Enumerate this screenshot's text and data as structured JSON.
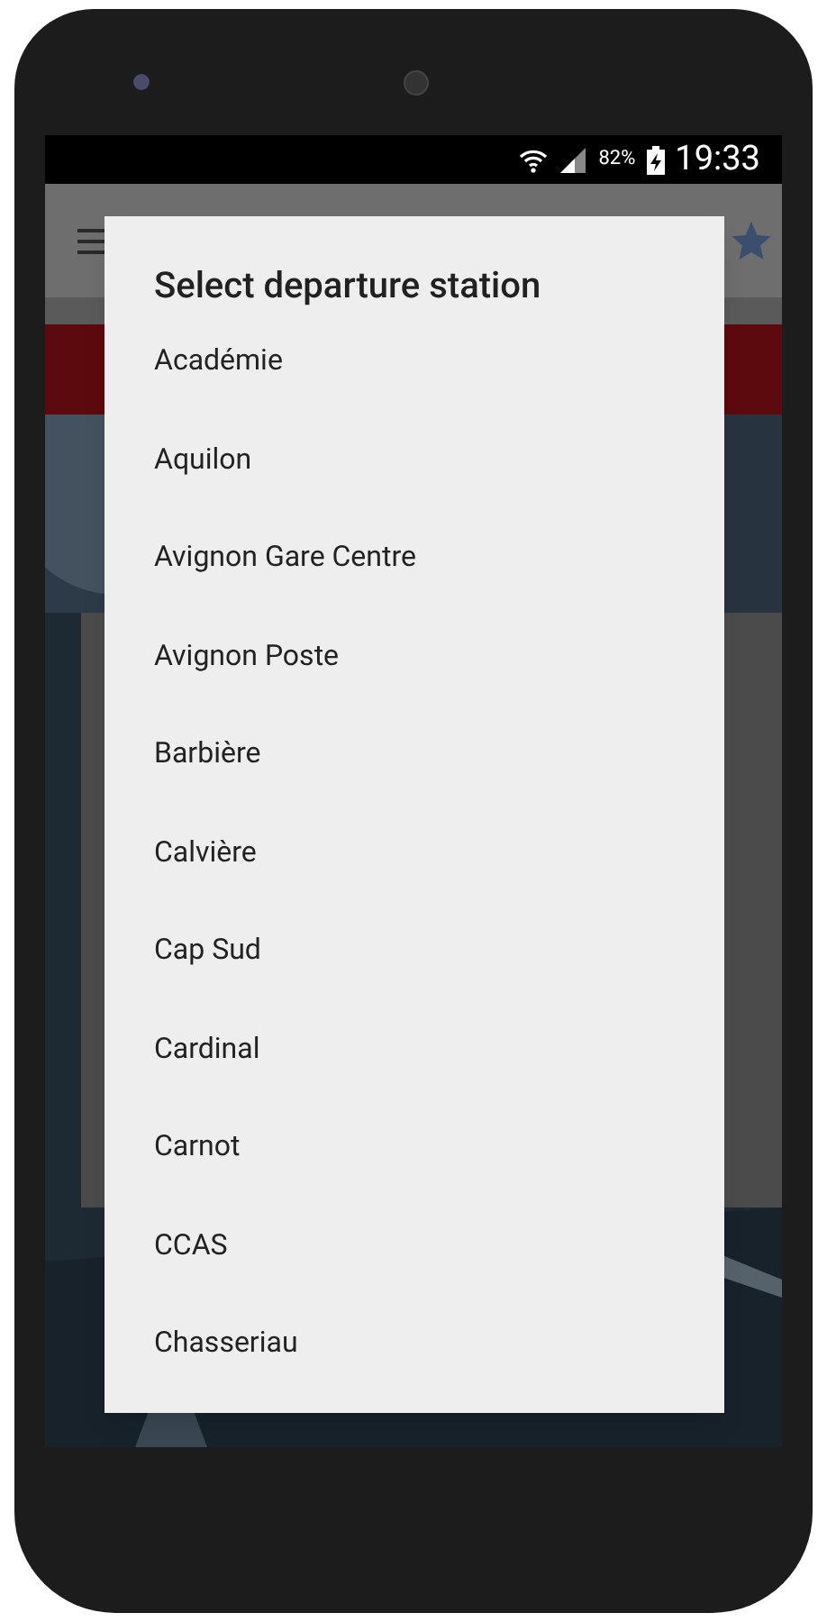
{
  "status_bar": {
    "battery": "82%",
    "time": "19:33"
  },
  "dialog": {
    "title": "Select departure station",
    "items": [
      "Académie",
      "Aquilon",
      "Avignon Gare Centre",
      "Avignon Poste",
      "Barbière",
      "Calvière",
      "Cap Sud",
      "Cardinal",
      "Carnot",
      "CCAS",
      "Chasseriau"
    ]
  }
}
